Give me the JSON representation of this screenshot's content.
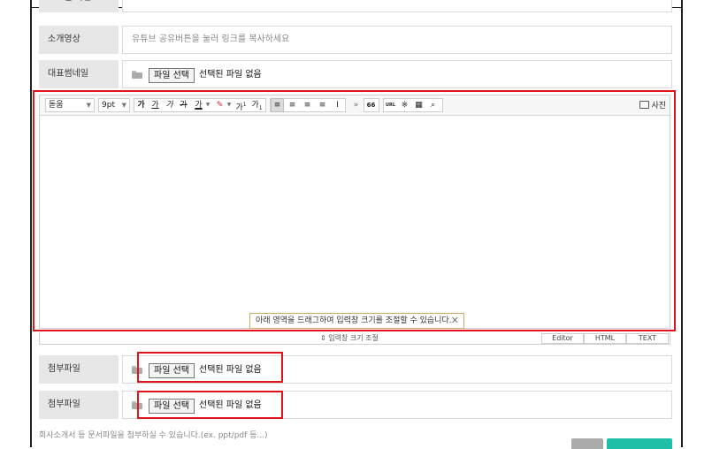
{
  "rows": {
    "top_field": {
      "label": "프로필 사진",
      "value": ""
    },
    "intro_video": {
      "label": "소개영상",
      "placeholder": "유튜브 공유버튼을 눌러 링크를 복사하세요"
    },
    "thumbnail": {
      "label": "대표썸네일",
      "file_button": "파일 선택",
      "file_status": "선택된 파일 없음"
    },
    "attachment1": {
      "label": "첨부파일",
      "file_button": "파일 선택",
      "file_status": "선택된 파일 없음"
    },
    "attachment2": {
      "label": "첨부파일",
      "file_button": "파일 선택",
      "file_status": "선택된 파일 없음"
    }
  },
  "editor": {
    "font_family": "돋움",
    "font_size": "9pt",
    "format_icons": [
      "가",
      "가",
      "가",
      "가",
      "가",
      "가",
      "가",
      "가"
    ],
    "more_icon": "»",
    "quote_icon": "66",
    "url_label": "URL",
    "photo_label": "사진",
    "resize_hint": "아래 영역을 드래그하여 입력창 크기를 조절할 수 있습니다.",
    "resize_label": "입력창 크기 조절",
    "modes": [
      "Editor",
      "HTML",
      "TEXT"
    ]
  },
  "help_text": "회사소개서 등 문서파일을 첨부하실 수 있습니다.(ex. ppt/pdf 등...)",
  "colors": {
    "highlight": "#e0141b",
    "primary_button": "#1fbfa8",
    "secondary_button": "#aaaaaa"
  }
}
